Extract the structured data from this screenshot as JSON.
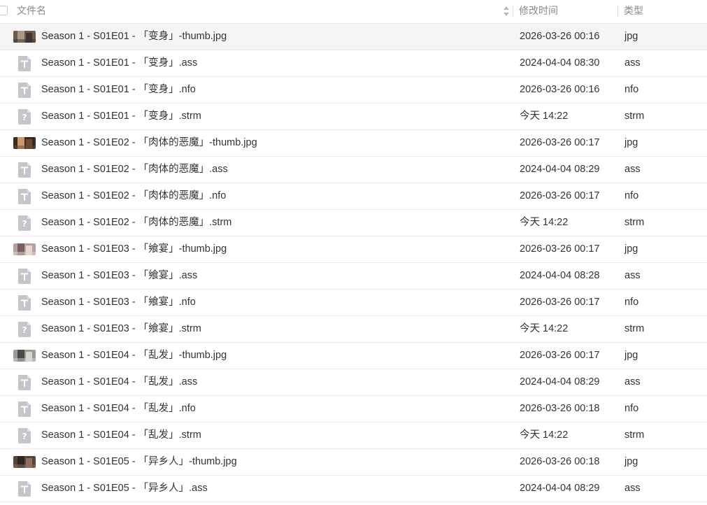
{
  "header": {
    "name_label": "文件名",
    "date_label": "修改时间",
    "type_label": "类型"
  },
  "colors": {
    "header_text": "#8a8a8a",
    "row_text": "#333333",
    "row_border": "#ebebeb",
    "first_row_bg": "#f5f5f5",
    "icon_gray": "#c4c6cc"
  },
  "rows": [
    {
      "name": "Season 1 - S01E01 - 「变身」-thumb.jpg",
      "modified": "2026-03-26 00:16",
      "type": "jpg",
      "icon": "image-thumbnail-icon"
    },
    {
      "name": "Season 1 - S01E01 - 「变身」.ass",
      "modified": "2024-04-04 08:30",
      "type": "ass",
      "icon": "text-file-icon"
    },
    {
      "name": "Season 1 - S01E01 - 「变身」.nfo",
      "modified": "2026-03-26 00:16",
      "type": "nfo",
      "icon": "text-file-icon"
    },
    {
      "name": "Season 1 - S01E01 - 「变身」.strm",
      "modified": "今天 14:22",
      "type": "strm",
      "icon": "unknown-file-icon"
    },
    {
      "name": "Season 1 - S01E02 - 「肉体的恶魔」-thumb.jpg",
      "modified": "2026-03-26 00:17",
      "type": "jpg",
      "icon": "image-thumbnail-icon"
    },
    {
      "name": "Season 1 - S01E02 - 「肉体的恶魔」.ass",
      "modified": "2024-04-04 08:29",
      "type": "ass",
      "icon": "text-file-icon"
    },
    {
      "name": "Season 1 - S01E02 - 「肉体的恶魔」.nfo",
      "modified": "2026-03-26 00:17",
      "type": "nfo",
      "icon": "text-file-icon"
    },
    {
      "name": "Season 1 - S01E02 - 「肉体的恶魔」.strm",
      "modified": "今天 14:22",
      "type": "strm",
      "icon": "unknown-file-icon"
    },
    {
      "name": "Season 1 - S01E03 - 「飨宴」-thumb.jpg",
      "modified": "2026-03-26 00:17",
      "type": "jpg",
      "icon": "image-thumbnail-icon"
    },
    {
      "name": "Season 1 - S01E03 - 「飨宴」.ass",
      "modified": "2024-04-04 08:28",
      "type": "ass",
      "icon": "text-file-icon"
    },
    {
      "name": "Season 1 - S01E03 - 「飨宴」.nfo",
      "modified": "2026-03-26 00:17",
      "type": "nfo",
      "icon": "text-file-icon"
    },
    {
      "name": "Season 1 - S01E03 - 「飨宴」.strm",
      "modified": "今天 14:22",
      "type": "strm",
      "icon": "unknown-file-icon"
    },
    {
      "name": "Season 1 - S01E04 - 「乱发」-thumb.jpg",
      "modified": "2026-03-26 00:17",
      "type": "jpg",
      "icon": "image-thumbnail-icon"
    },
    {
      "name": "Season 1 - S01E04 - 「乱发」.ass",
      "modified": "2024-04-04 08:29",
      "type": "ass",
      "icon": "text-file-icon"
    },
    {
      "name": "Season 1 - S01E04 - 「乱发」.nfo",
      "modified": "2026-03-26 00:18",
      "type": "nfo",
      "icon": "text-file-icon"
    },
    {
      "name": "Season 1 - S01E04 - 「乱发」.strm",
      "modified": "今天 14:22",
      "type": "strm",
      "icon": "unknown-file-icon"
    },
    {
      "name": "Season 1 - S01E05 - 「异乡人」-thumb.jpg",
      "modified": "2026-03-26 00:18",
      "type": "jpg",
      "icon": "image-thumbnail-icon"
    },
    {
      "name": "Season 1 - S01E05 - 「异乡人」.ass",
      "modified": "2024-04-04 08:29",
      "type": "ass",
      "icon": "text-file-icon"
    }
  ]
}
